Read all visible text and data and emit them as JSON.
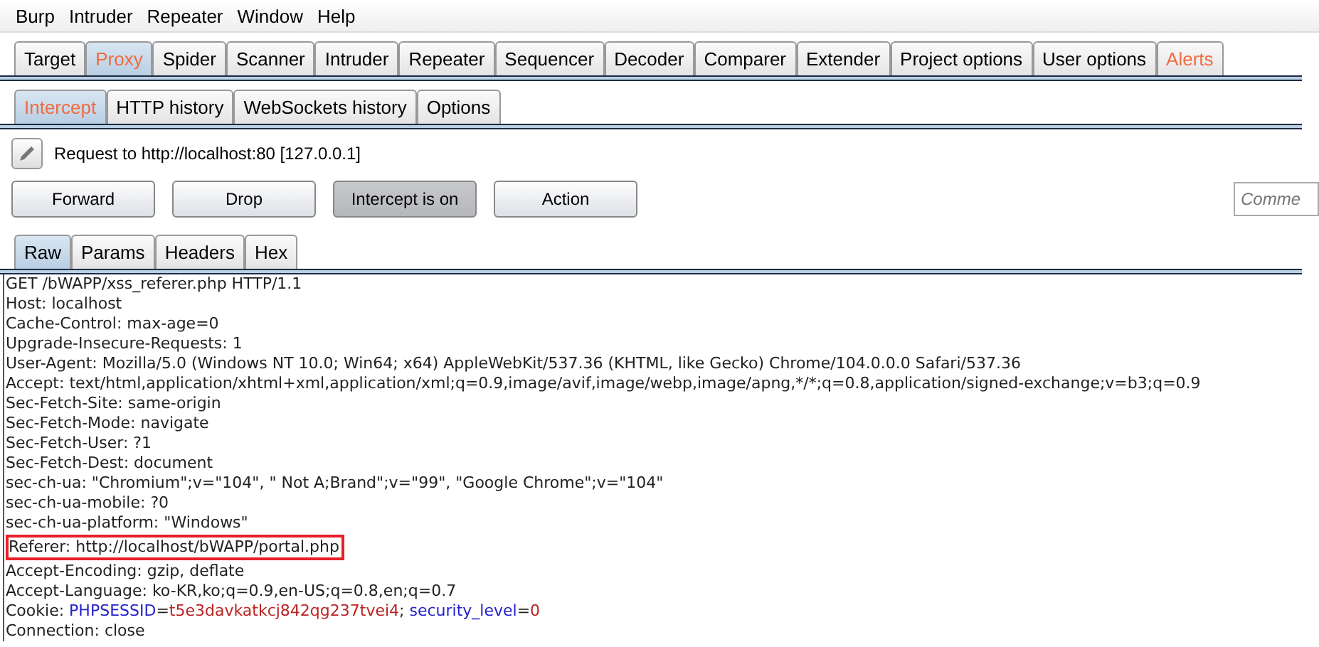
{
  "menu": [
    "Burp",
    "Intruder",
    "Repeater",
    "Window",
    "Help"
  ],
  "main_tabs": [
    {
      "label": "Target",
      "selected": false,
      "alert": false
    },
    {
      "label": "Proxy",
      "selected": true,
      "alert": true
    },
    {
      "label": "Spider",
      "selected": false,
      "alert": false
    },
    {
      "label": "Scanner",
      "selected": false,
      "alert": false
    },
    {
      "label": "Intruder",
      "selected": false,
      "alert": false
    },
    {
      "label": "Repeater",
      "selected": false,
      "alert": false
    },
    {
      "label": "Sequencer",
      "selected": false,
      "alert": false
    },
    {
      "label": "Decoder",
      "selected": false,
      "alert": false
    },
    {
      "label": "Comparer",
      "selected": false,
      "alert": false
    },
    {
      "label": "Extender",
      "selected": false,
      "alert": false
    },
    {
      "label": "Project options",
      "selected": false,
      "alert": false
    },
    {
      "label": "User options",
      "selected": false,
      "alert": false
    },
    {
      "label": "Alerts",
      "selected": false,
      "alert": true
    }
  ],
  "sub_tabs": [
    {
      "label": "Intercept",
      "selected": true,
      "alert": true
    },
    {
      "label": "HTTP history",
      "selected": false,
      "alert": false
    },
    {
      "label": "WebSockets history",
      "selected": false,
      "alert": false
    },
    {
      "label": "Options",
      "selected": false,
      "alert": false
    }
  ],
  "request_info": "Request to http://localhost:80  [127.0.0.1]",
  "buttons": [
    {
      "label": "Forward",
      "pressed": false
    },
    {
      "label": "Drop",
      "pressed": false
    },
    {
      "label": "Intercept is on",
      "pressed": true
    },
    {
      "label": "Action",
      "pressed": false
    }
  ],
  "comment": {
    "placeholder": "Comme"
  },
  "view_tabs": [
    {
      "label": "Raw",
      "selected": true
    },
    {
      "label": "Params",
      "selected": false
    },
    {
      "label": "Headers",
      "selected": false
    },
    {
      "label": "Hex",
      "selected": false
    }
  ],
  "request_lines": [
    {
      "text": "GET /bWAPP/xss_referer.php HTTP/1.1",
      "highlighted": false
    },
    {
      "text": "Host: localhost",
      "highlighted": false
    },
    {
      "text": "Cache-Control: max-age=0",
      "highlighted": false
    },
    {
      "text": "Upgrade-Insecure-Requests: 1",
      "highlighted": false
    },
    {
      "text": "User-Agent: Mozilla/5.0 (Windows NT 10.0; Win64; x64) AppleWebKit/537.36 (KHTML, like Gecko) Chrome/104.0.0.0 Safari/537.36",
      "highlighted": false
    },
    {
      "text": "Accept: text/html,application/xhtml+xml,application/xml;q=0.9,image/avif,image/webp,image/apng,*/*;q=0.8,application/signed-exchange;v=b3;q=0.9",
      "highlighted": false
    },
    {
      "text": "Sec-Fetch-Site: same-origin",
      "highlighted": false
    },
    {
      "text": "Sec-Fetch-Mode: navigate",
      "highlighted": false
    },
    {
      "text": "Sec-Fetch-User: ?1",
      "highlighted": false
    },
    {
      "text": "Sec-Fetch-Dest: document",
      "highlighted": false
    },
    {
      "text": "sec-ch-ua: \"Chromium\";v=\"104\", \" Not A;Brand\";v=\"99\", \"Google Chrome\";v=\"104\"",
      "highlighted": false
    },
    {
      "text": "sec-ch-ua-mobile: ?0",
      "highlighted": false
    },
    {
      "text": "sec-ch-ua-platform: \"Windows\"",
      "highlighted": false
    },
    {
      "text": "Referer: http://localhost/bWAPP/portal.php",
      "highlighted": true
    },
    {
      "text": "Accept-Encoding: gzip, deflate",
      "highlighted": false
    },
    {
      "text": "Accept-Language: ko-KR,ko;q=0.9,en-US;q=0.8,en;q=0.7",
      "highlighted": false
    },
    {
      "segments": [
        {
          "kind": "plain",
          "text": "Cookie: "
        },
        {
          "kind": "name",
          "text": "PHPSESSID"
        },
        {
          "kind": "plain",
          "text": "="
        },
        {
          "kind": "value",
          "text": "t5e3davkatkcj842qg237tvei4"
        },
        {
          "kind": "plain",
          "text": "; "
        },
        {
          "kind": "name",
          "text": "security_level"
        },
        {
          "kind": "plain",
          "text": "="
        },
        {
          "kind": "value",
          "text": "0"
        }
      ],
      "highlighted": false
    },
    {
      "text": "Connection: close",
      "highlighted": false
    }
  ]
}
